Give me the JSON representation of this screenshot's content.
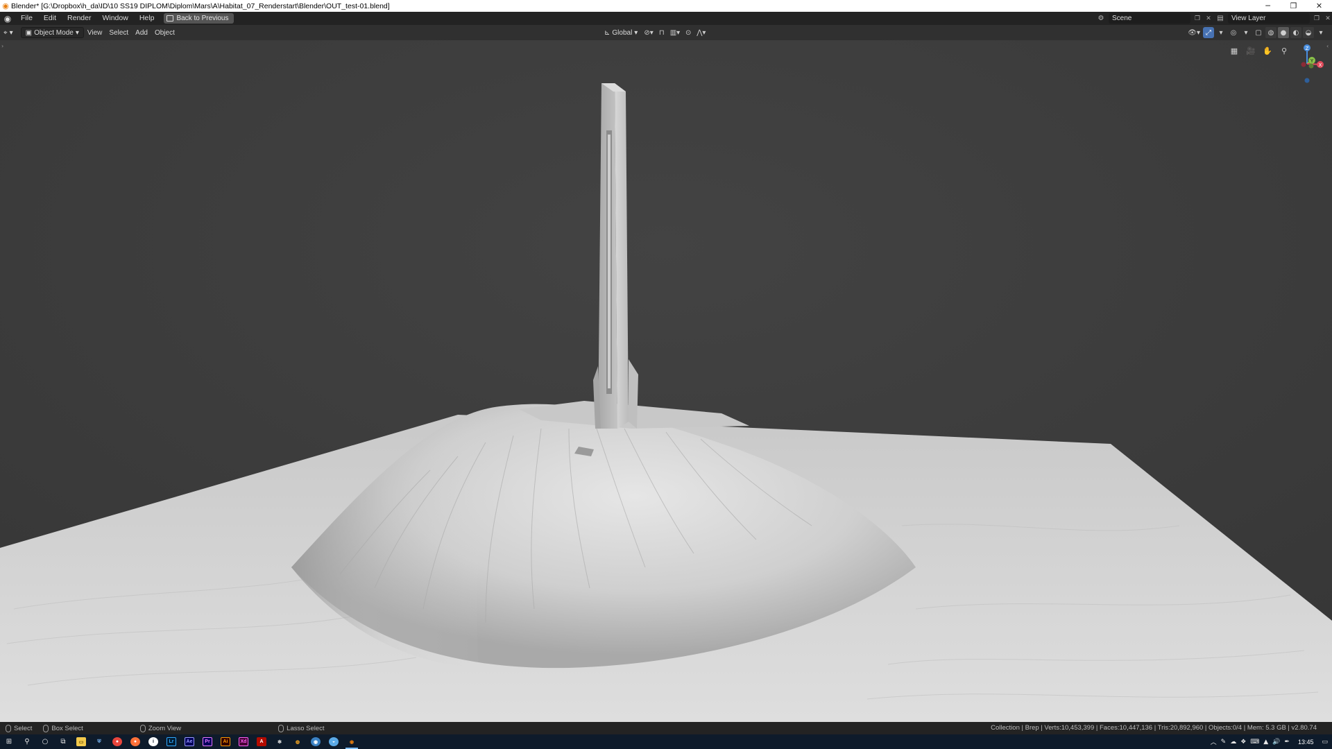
{
  "window": {
    "title": "Blender* [G:\\Dropbox\\h_da\\ID\\10 SS19 DIPLOM\\Diplom\\Mars\\A\\Habitat_07_Renderstart\\Blender\\OUT_test-01.blend]",
    "controls": [
      "minimize",
      "restore",
      "close"
    ]
  },
  "menubar": {
    "items": [
      "File",
      "Edit",
      "Render",
      "Window",
      "Help"
    ],
    "back_button": "Back to Previous",
    "scene": {
      "label": "Scene"
    },
    "view_layer": {
      "label": "View Layer"
    }
  },
  "viewport_header": {
    "mode": "Object Mode",
    "menus": [
      "View",
      "Select",
      "Add",
      "Object"
    ],
    "transform_orientation": "Global",
    "shading_active": "solid"
  },
  "gizmo": {
    "axes": [
      "Z",
      "Y",
      "X"
    ]
  },
  "colors": {
    "accent": "#4772b3",
    "axis_x": "#e04a5a",
    "axis_y": "#8bc34a",
    "axis_z": "#4a8fe0",
    "viewport_bg": "#3d3d3d",
    "terrain": "#dadada"
  },
  "statusbar": {
    "items": [
      {
        "label": "Select"
      },
      {
        "label": "Box Select"
      },
      {
        "label": "Zoom View"
      },
      {
        "label": "Lasso Select"
      }
    ],
    "stats": "Collection | Brep | Verts:10,453,399 | Faces:10,447,136 | Tris:20,892,960 | Objects:0/4 | Mem: 5.3 GB | v2.80.74"
  },
  "taskbar": {
    "apps": [
      "start",
      "search",
      "cortana",
      "task-view",
      "file-explorer",
      "defender",
      "chrome",
      "firefox",
      "info",
      "Lr",
      "Ae",
      "Pr",
      "Ai",
      "Xd",
      "acrobat",
      "app-1",
      "app-2",
      "app-3",
      "app-4",
      "blender"
    ],
    "active_app": "blender",
    "clock": "13:45"
  }
}
